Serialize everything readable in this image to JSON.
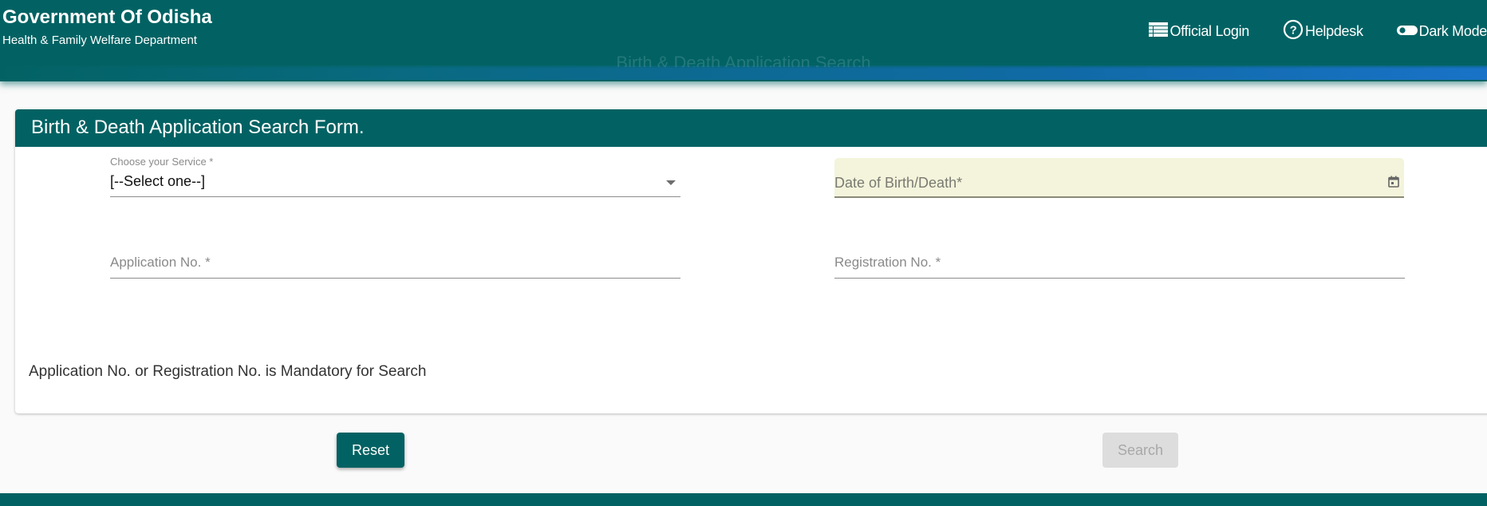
{
  "header": {
    "title": "Government Of Odisha",
    "subtitle": "Health & Family Welfare Department",
    "ghost_title": "Birth & Death Application Search",
    "nav": [
      {
        "label": "Official Login",
        "icon": "list-icon"
      },
      {
        "label": "Helpdesk",
        "icon": "help-circle-icon"
      },
      {
        "label": "Dark Mode",
        "icon": "toggle-icon"
      }
    ]
  },
  "form": {
    "title": "Birth & Death Application Search Form.",
    "service": {
      "label": "Choose your Service *",
      "selected": "[--Select one--]"
    },
    "date": {
      "placeholder": "Date of Birth/Death*",
      "icon": "calendar-icon"
    },
    "application_no": {
      "placeholder": "Application No. *",
      "value": ""
    },
    "registration_no": {
      "placeholder": "Registration No. *",
      "value": ""
    },
    "note": "Application No. or Registration No. is Mandatory for Search"
  },
  "actions": {
    "reset_label": "Reset",
    "search_label": "Search",
    "search_disabled": true
  },
  "colors": {
    "primary": "#026263",
    "date_field_bg": "#f3f4db",
    "disabled_bg": "#dddddd"
  }
}
